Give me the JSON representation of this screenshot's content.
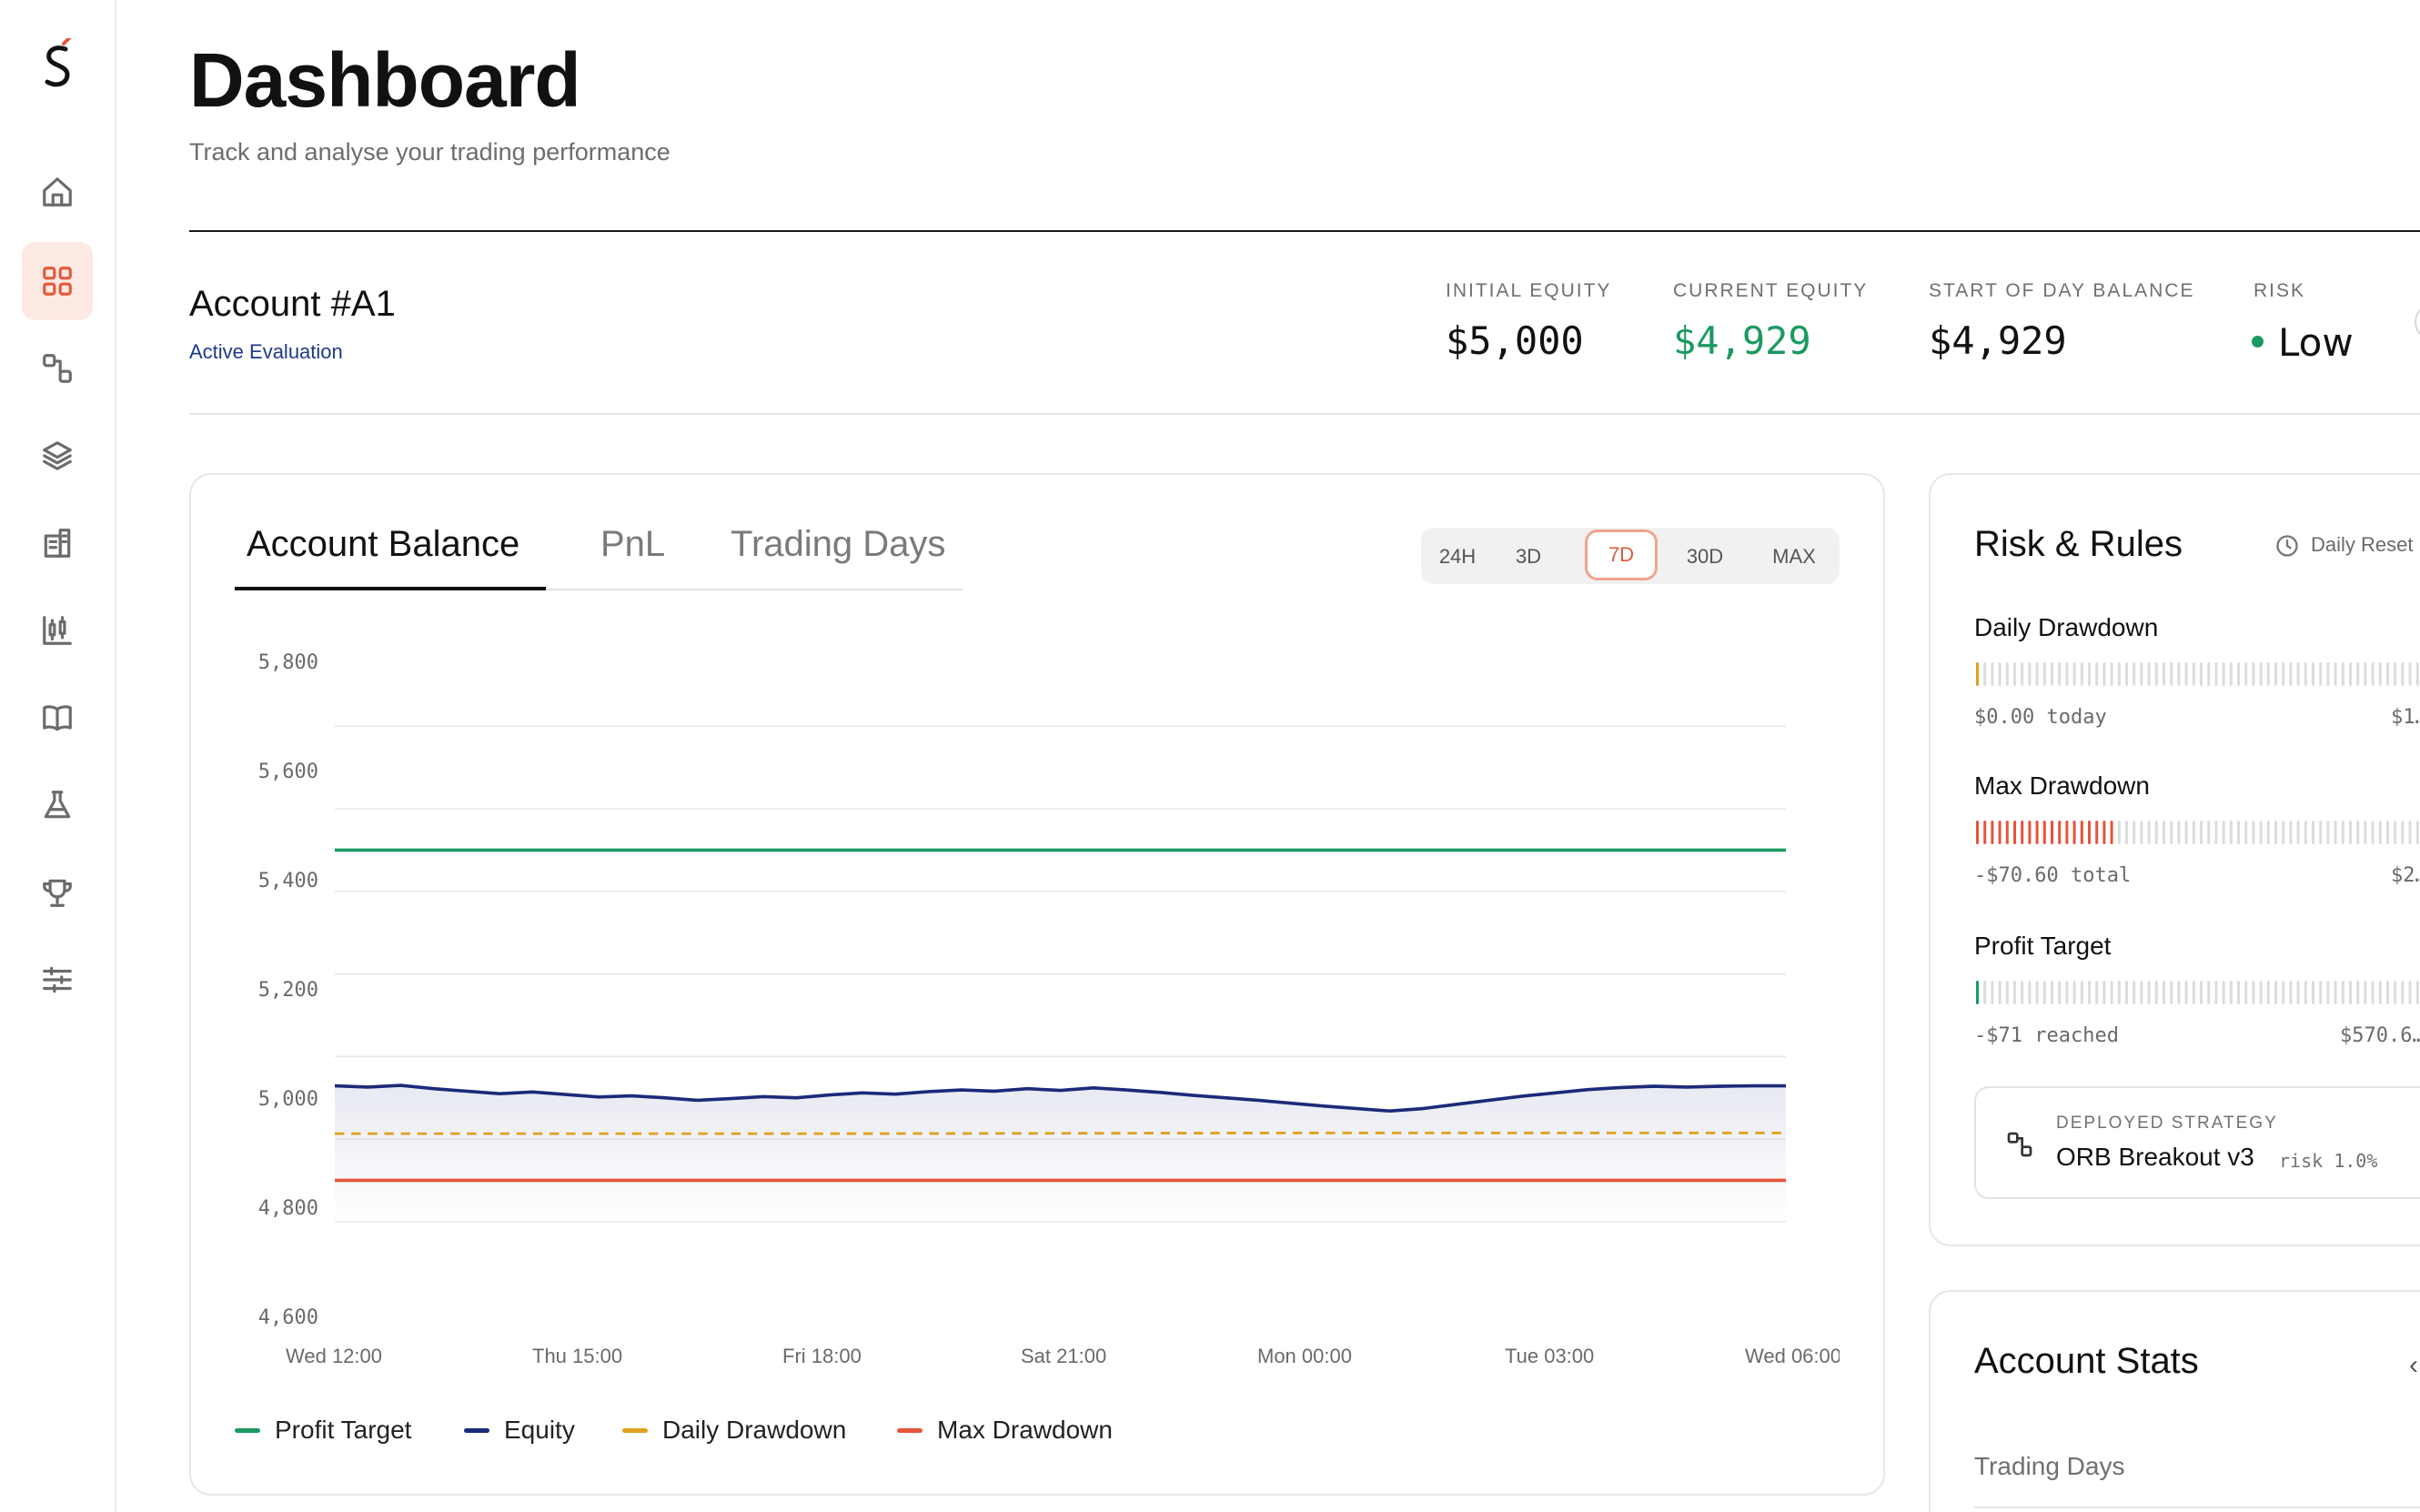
{
  "sidebar": {
    "logo": "S",
    "items": [
      {
        "icon": "home-icon"
      },
      {
        "icon": "dashboard-grid-icon",
        "active": true
      },
      {
        "icon": "strategy-nodes-icon"
      },
      {
        "icon": "layers-icon"
      },
      {
        "icon": "building-icon"
      },
      {
        "icon": "candlestick-chart-icon"
      },
      {
        "icon": "book-icon"
      },
      {
        "icon": "flask-icon"
      },
      {
        "icon": "trophy-icon"
      },
      {
        "icon": "sliders-icon"
      }
    ]
  },
  "header": {
    "title": "Dashboard",
    "subtitle": "Track and analyse your trading performance"
  },
  "account": {
    "name": "Account #A1",
    "status": "Active Evaluation",
    "stats": [
      {
        "label": "INITIAL EQUITY",
        "value": "$5,000"
      },
      {
        "label": "CURRENT EQUITY",
        "value": "$4,929"
      },
      {
        "label": "START OF DAY BALANCE",
        "value": "$4,929"
      },
      {
        "label": "RISK",
        "value": "Low"
      }
    ]
  },
  "chart_card": {
    "tabs": [
      "Account Balance",
      "PnL",
      "Trading Days"
    ],
    "active_tab": "Account Balance",
    "ranges": [
      "24H",
      "3D",
      "7D",
      "30D",
      "MAX"
    ],
    "active_range": "7D"
  },
  "chart_data": {
    "type": "line",
    "x_ticks": [
      "Wed 12:00",
      "Thu 15:00",
      "Fri 18:00",
      "Sat 21:00",
      "Mon 00:00",
      "Tue 03:00",
      "Wed 06:00"
    ],
    "y_ticks": [
      "5,800",
      "5,600",
      "5,400",
      "5,200",
      "5,000",
      "4,800",
      "4,600"
    ],
    "ylim": [
      4600,
      5800
    ],
    "grid": true,
    "legend_placement": "bottom-left",
    "series": [
      {
        "name": "Profit Target",
        "color": "#1a9a60",
        "style": "solid",
        "values": [
          5500,
          5500
        ]
      },
      {
        "name": "Equity",
        "color": "#1b2a7a",
        "style": "solid",
        "area": true,
        "values": [
          4929,
          4926,
          4930,
          4922,
          4916,
          4910,
          4914,
          4908,
          4902,
          4905,
          4900,
          4894,
          4898,
          4903,
          4900,
          4907,
          4912,
          4909,
          4915,
          4919,
          4916,
          4922,
          4918,
          4924,
          4919,
          4913,
          4906,
          4900,
          4894,
          4887,
          4880,
          4874,
          4868,
          4874,
          4884,
          4894,
          4904,
          4912,
          4920,
          4925,
          4928,
          4926,
          4928,
          4929,
          4929
        ]
      },
      {
        "name": "Daily Drawdown",
        "color": "#e0a020",
        "style": "dashed",
        "values": [
          4813,
          4813,
          4815,
          4815
        ]
      },
      {
        "name": "Max Drawdown",
        "color": "#e8533a",
        "style": "solid",
        "values": [
          4700,
          4700
        ]
      }
    ]
  },
  "risk_card": {
    "title": "Risk & Rules",
    "reset_label": "Daily Reset",
    "rules": [
      {
        "name": "Daily Drawdown",
        "footer": "$0.00 today",
        "limit": "$1…",
        "progress": 0.0,
        "color": "#e0a020"
      },
      {
        "name": "Max Drawdown",
        "footer": "-$70.60 total",
        "limit": "$2…",
        "progress": 0.3,
        "color": "#e8533a"
      },
      {
        "name": "Profit Target",
        "footer": "-$71 reached",
        "limit": "$570.6…",
        "progress": 0.0,
        "color": "#1a9a60"
      }
    ],
    "strategy": {
      "label": "DEPLOYED STRATEGY",
      "name": "ORB Breakout v3",
      "risk": "risk 1.0%"
    }
  },
  "stats_card": {
    "title": "Account Stats",
    "first_row": "Trading Days"
  }
}
